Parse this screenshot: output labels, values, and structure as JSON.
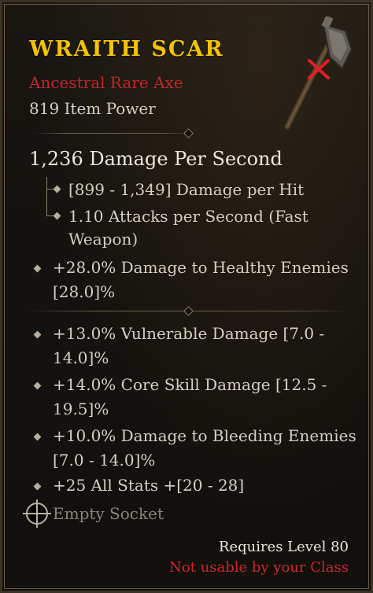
{
  "item": {
    "name": "WRAITH SCAR",
    "type": "Ancestral Rare Axe",
    "item_power": "819 Item Power"
  },
  "damage": {
    "dps": "1,236 Damage Per Second",
    "per_hit": "[899 - 1,349] Damage per Hit",
    "attacks": "1.10 Attacks per Second (Fast",
    "attacks_cont": "Weapon)"
  },
  "implicit": {
    "line1": "+28.0% Damage to Healthy Enemies",
    "line2": "[28.0]%"
  },
  "affixes": [
    {
      "line1": "+13.0% Vulnerable Damage [7.0 -",
      "line2": "14.0]%"
    },
    {
      "line1": "+14.0% Core Skill Damage [12.5 -",
      "line2": "19.5]%"
    },
    {
      "line1": "+10.0% Damage to Bleeding Enemies",
      "line2": "[7.0 - 14.0]%"
    },
    {
      "line1": "+25 All Stats +[20 - 28]",
      "line2": ""
    }
  ],
  "socket": {
    "label": "Empty Socket"
  },
  "requirements": {
    "level": "Requires Level 80",
    "class": "Not usable by your Class"
  },
  "colors": {
    "title": "#f2c400",
    "rare": "#c0262a",
    "warning": "#d0272c"
  },
  "icons": {
    "item": "axe-icon",
    "unusable": "red-x-icon",
    "socket": "socket-icon"
  }
}
